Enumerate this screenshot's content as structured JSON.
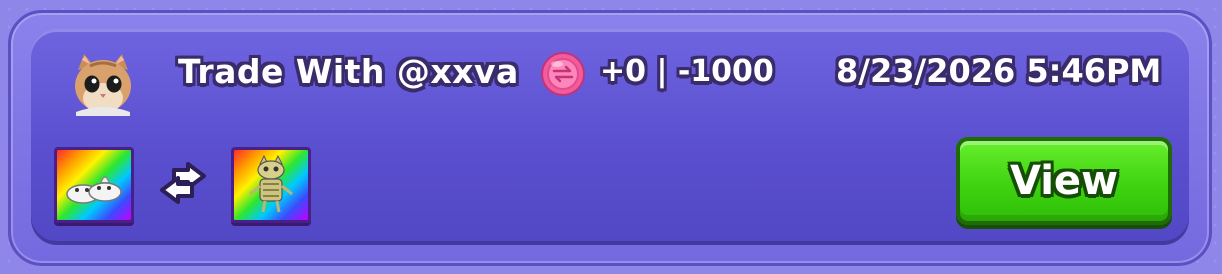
{
  "trade": {
    "title": "Trade With @xxva",
    "delta": "+0 | -1000",
    "datetime": "8/23/2026 5:46PM",
    "currency_icon": "pink-coin-icon",
    "avatar_icon": "cat-avatar-icon"
  },
  "items": {
    "given": {
      "icon": "white-slippers-icon",
      "background": "rainbow"
    },
    "received": {
      "icon": "golden-robot-cat-icon",
      "background": "rainbow"
    },
    "swap_icon": "swap-arrows-icon"
  },
  "actions": {
    "view_label": "View"
  },
  "colors": {
    "card": "#5a4fcf",
    "button": "#3fd311",
    "coin": "#ff6fb0"
  }
}
